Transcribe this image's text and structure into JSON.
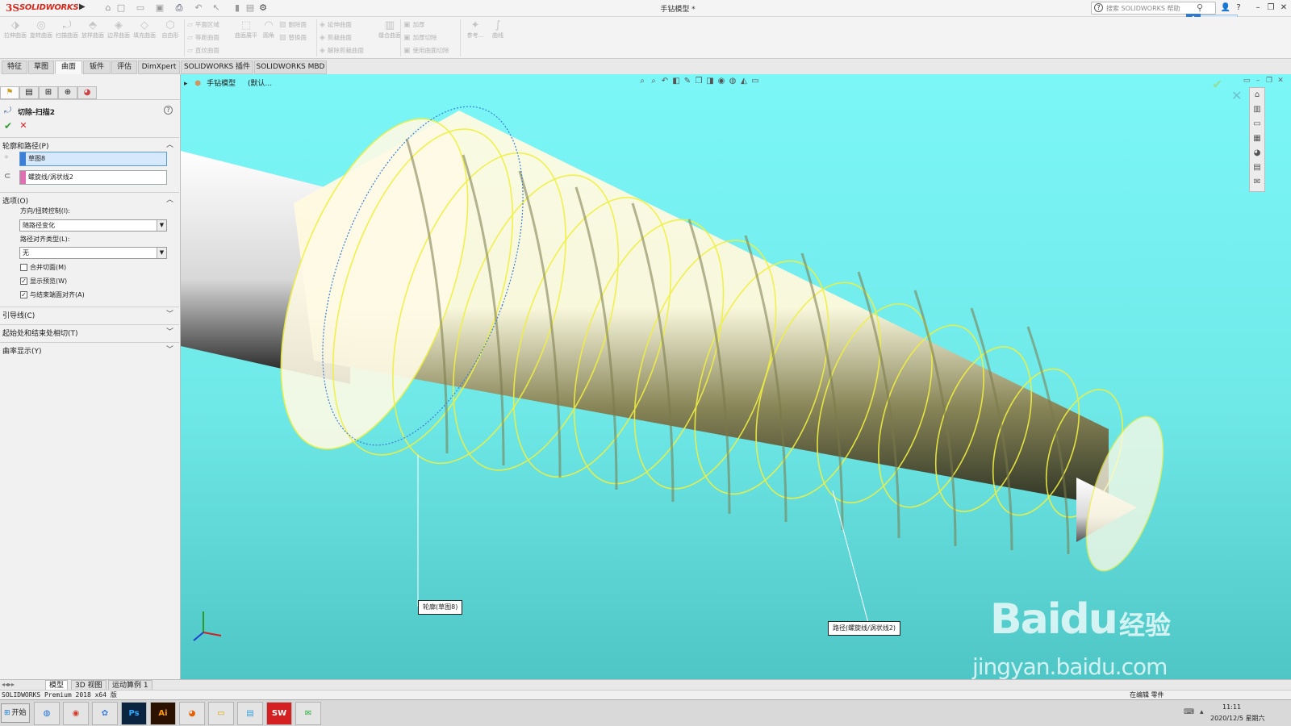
{
  "titlebar": {
    "logo_text": "SOLIDWORKS",
    "doc_title": "手钻模型 *",
    "search_placeholder": "搜索 SOLIDWORKS 帮助"
  },
  "ribbon": {
    "big_buttons": [
      {
        "label": "拉伸曲面",
        "icon": "extrude-surface-icon"
      },
      {
        "label": "旋转曲面",
        "icon": "revolve-surface-icon"
      },
      {
        "label": "扫描曲面",
        "icon": "sweep-surface-icon"
      },
      {
        "label": "放样曲面",
        "icon": "loft-surface-icon"
      },
      {
        "label": "边界曲面",
        "icon": "boundary-surface-icon"
      },
      {
        "label": "填充曲面",
        "icon": "fill-surface-icon"
      },
      {
        "label": "自由形",
        "icon": "freeform-icon"
      }
    ],
    "group2": [
      "平面区域",
      "等距曲面",
      "直纹曲面"
    ],
    "big2": {
      "label": "曲面展平"
    },
    "big3": {
      "label": "圆角"
    },
    "group3": [
      "删除面",
      "替换面"
    ],
    "group4": [
      "延伸曲面",
      "剪裁曲面",
      "解除剪裁曲面"
    ],
    "big4": {
      "label": "缝合曲面"
    },
    "group5": [
      "加厚",
      "加厚切除",
      "使用曲面切除"
    ],
    "big5": {
      "label": "参考..."
    },
    "big6": {
      "label": "曲线"
    }
  },
  "tabs": [
    {
      "label": "特征",
      "active": false
    },
    {
      "label": "草图",
      "active": false
    },
    {
      "label": "曲面",
      "active": true
    },
    {
      "label": "钣件",
      "active": false
    },
    {
      "label": "评估",
      "active": false
    },
    {
      "label": "DimXpert",
      "active": false
    },
    {
      "label": "SOLIDWORKS 插件",
      "active": false
    },
    {
      "label": "SOLIDWORKS MBD",
      "active": false
    }
  ],
  "property_manager": {
    "title": "切除-扫描2",
    "profile_path": {
      "heading": "轮廓和路径(P)",
      "profile_value": "草图8",
      "path_value": "螺旋线/涡状线2"
    },
    "options": {
      "heading": "选项(O)",
      "orientation_label": "方向/扭转控制(I):",
      "orientation_value": "随路径变化",
      "path_align_label": "路径对齐类型(L):",
      "path_align_value": "无",
      "checkboxes": [
        {
          "label": "合并切面(M)",
          "checked": false
        },
        {
          "label": "显示预览(W)",
          "checked": true
        },
        {
          "label": "与结束端面对齐(A)",
          "checked": true
        }
      ]
    },
    "collapsed_groups": [
      "引导线(C)",
      "起始处和结束处相切(T)",
      "曲率显示(Y)"
    ]
  },
  "viewport": {
    "breadcrumb_name": "手钻模型",
    "breadcrumb_suffix": "(默认...",
    "callout_profile": "轮廓(草图8)",
    "callout_path": "路径(螺旋线/涡状线2)"
  },
  "model_tabs": [
    {
      "label": "模型",
      "active": true
    },
    {
      "label": "3D 视图",
      "active": false
    },
    {
      "label": "运动算例 1",
      "active": false
    }
  ],
  "status": {
    "left": "SOLIDWORKS Premium 2018 x64 版",
    "editing": "在编辑 零件"
  },
  "taskbar": {
    "start_label": "开始",
    "apps": [
      "browser",
      "chrome",
      "baidu-netdisk",
      "Ps",
      "Ai",
      "firefox",
      "explorer",
      "notepad",
      "SW",
      "wechat"
    ],
    "time": "11:11",
    "date": "2020/12/5 星期六"
  },
  "watermark": {
    "brand": "Baidu",
    "brand_cn": "经验",
    "url": "jingyan.baidu.com"
  },
  "colors": {
    "viewport_bg": "#7cf7f7",
    "sweep_yellow": "#f0f040",
    "active_selection": "#d6e8fb"
  }
}
